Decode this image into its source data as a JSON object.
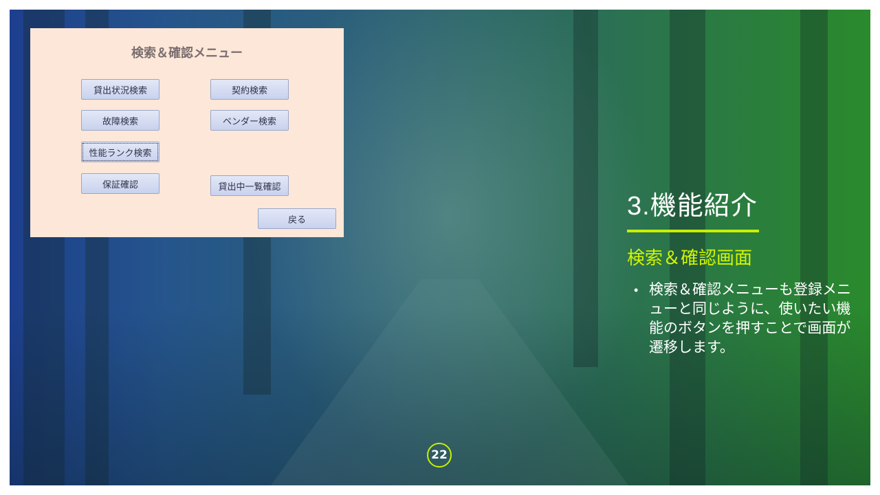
{
  "app": {
    "title": "検索＆確認メニュー",
    "buttons": {
      "rental_status_search": "貸出状況検索",
      "contract_search": "契約検索",
      "failure_search": "故障検索",
      "vendor_search": "ベンダー検索",
      "performance_rank_search": "性能ランク検索",
      "warranty_check": "保証確認",
      "rented_list_check": "貸出中一覧確認",
      "back": "戻る"
    }
  },
  "slide": {
    "title": "3.機能紹介",
    "subtitle": "検索＆確認画面",
    "bullets": [
      "検索＆確認メニューも登録メニューと同じように、使いたい機能のボタンを押すことで画面が遷移します。"
    ],
    "page_number": "22"
  },
  "colors": {
    "accent": "#c8f000",
    "subtitle": "#d2f500",
    "app_background": "#fde7d8",
    "button_fill": "#d3daf2"
  },
  "icons": {
    "bullet": "•"
  }
}
